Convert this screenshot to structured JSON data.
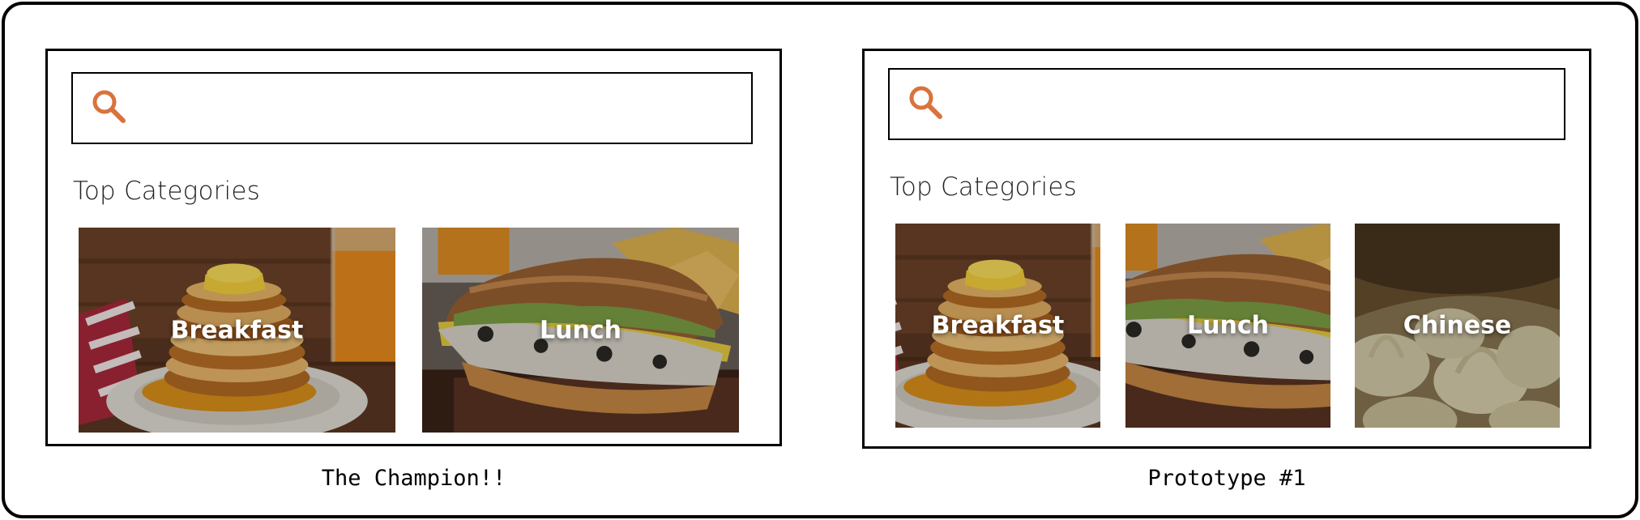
{
  "colors": {
    "accent": "#d9733e",
    "frame": "#000000"
  },
  "prototypes": [
    {
      "caption": "The Champion!!",
      "search": {
        "icon": "search-icon",
        "value": ""
      },
      "section_title": "Top Categories",
      "categories": [
        {
          "label": "Breakfast",
          "image": "pancakes-with-orange-juice"
        },
        {
          "label": "Lunch",
          "image": "sub-sandwich"
        }
      ]
    },
    {
      "caption": "Prototype #1",
      "search": {
        "icon": "search-icon",
        "value": ""
      },
      "section_title": "Top Categories",
      "categories": [
        {
          "label": "Breakfast",
          "image": "pancakes-with-orange-juice"
        },
        {
          "label": "Lunch",
          "image": "sub-sandwich"
        },
        {
          "label": "Chinese",
          "image": "soup-dumplings"
        }
      ]
    }
  ]
}
